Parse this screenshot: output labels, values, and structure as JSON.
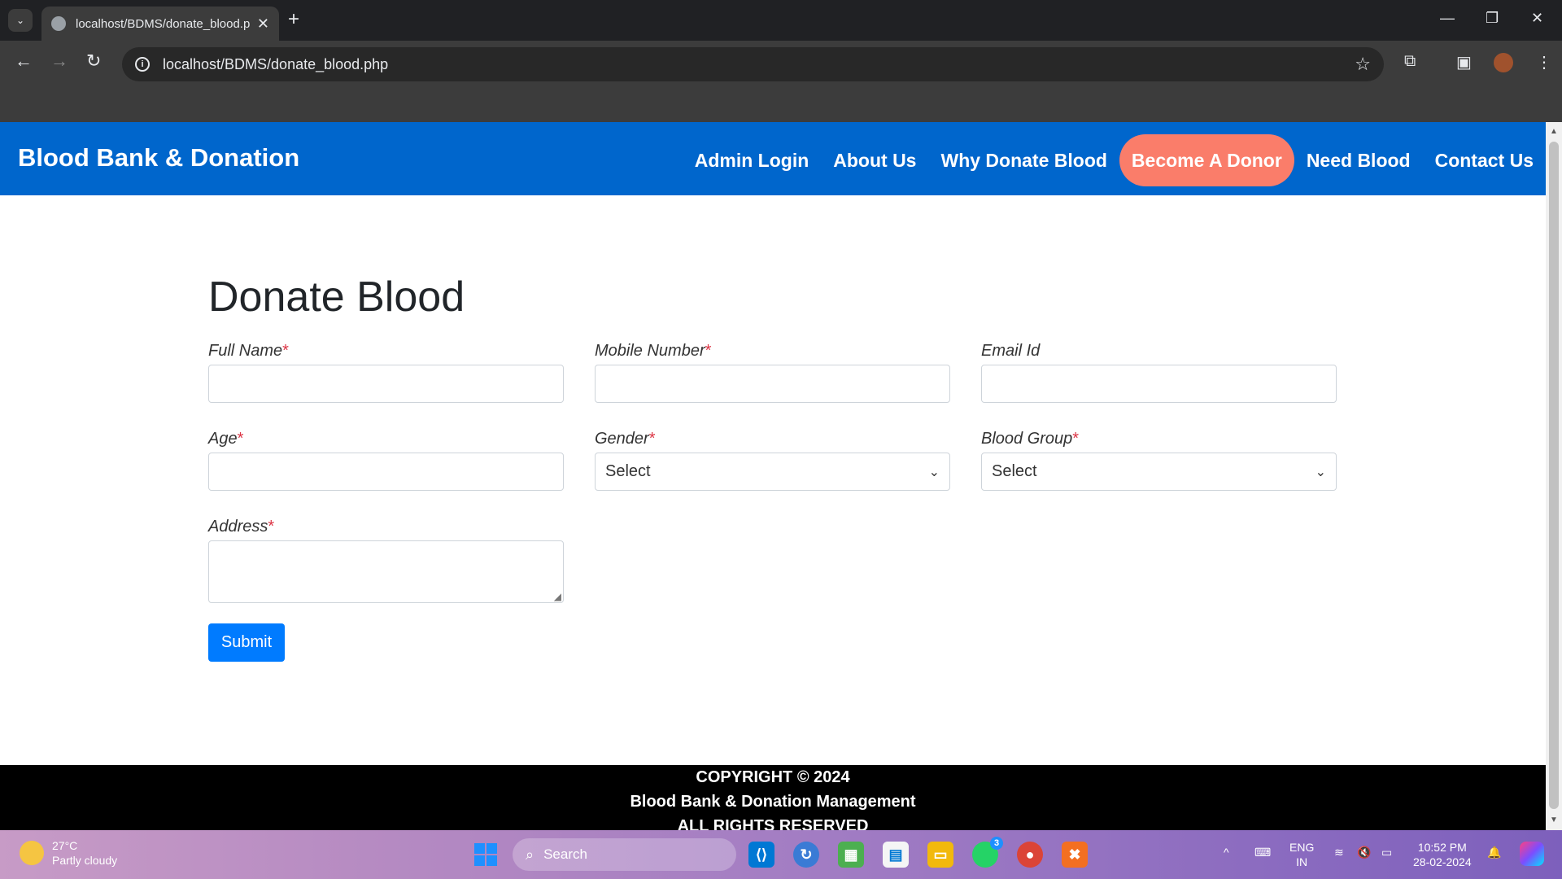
{
  "browser": {
    "tab_title": "localhost/BDMS/donate_blood.php",
    "url": "localhost/BDMS/donate_blood.php"
  },
  "site": {
    "brand": "Blood Bank & Donation",
    "nav": [
      {
        "label": "Admin Login"
      },
      {
        "label": "About Us"
      },
      {
        "label": "Why Donate Blood"
      },
      {
        "label": "Become A Donor",
        "active": true
      },
      {
        "label": "Need Blood"
      },
      {
        "label": "Contact Us"
      }
    ],
    "accent_color": "#0066cc",
    "active_color": "#fa7d6a"
  },
  "form": {
    "heading": "Donate Blood",
    "full_name_label": "Full Name",
    "mobile_label": "Mobile Number",
    "email_label": "Email Id",
    "age_label": "Age",
    "gender_label": "Gender",
    "gender_value": "Select",
    "blood_group_label": "Blood Group",
    "blood_group_value": "Select",
    "address_label": "Address",
    "required_marker": "*",
    "submit_label": "Submit"
  },
  "footer": {
    "line1": "COPYRIGHT © 2024",
    "line2": "Blood Bank & Donation Management",
    "line3": "ALL RIGHTS RESERVED"
  },
  "taskbar": {
    "temperature": "27°C",
    "weather": "Partly cloudy",
    "search_label": "Search",
    "lang_line1": "ENG",
    "lang_line2": "IN",
    "time": "10:52 PM",
    "date": "28-02-2024",
    "whatsapp_badge": "3"
  }
}
